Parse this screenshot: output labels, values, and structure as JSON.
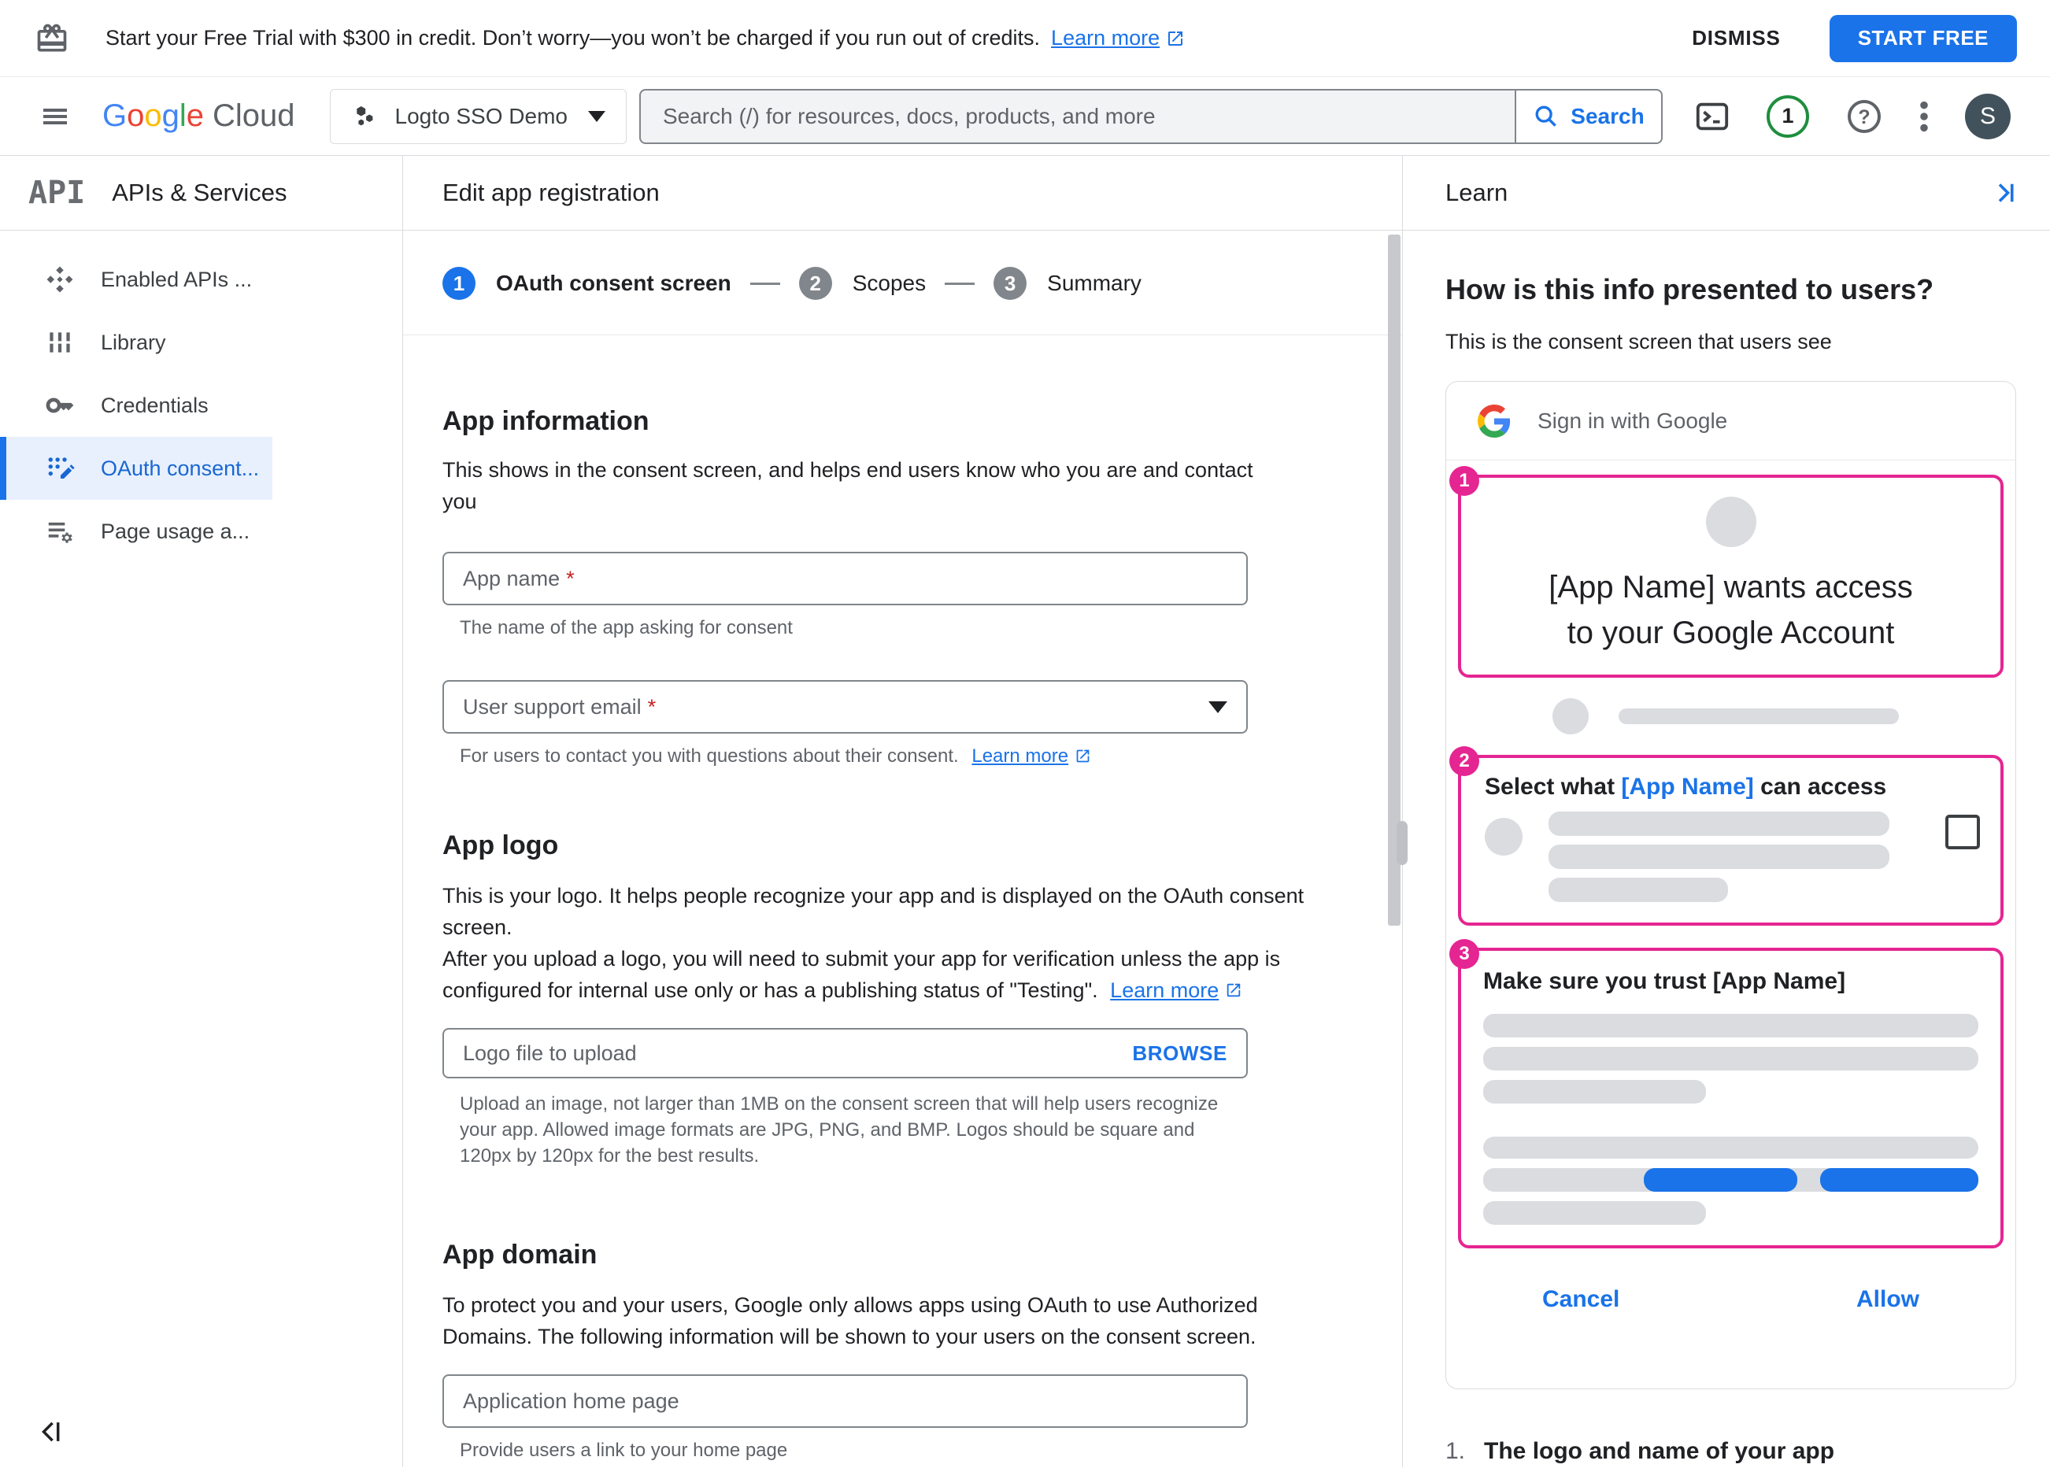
{
  "banner": {
    "message": "Start your Free Trial with $300 in credit. Don’t worry—you won’t be charged if you run out of credits.",
    "learn_more": "Learn more",
    "dismiss": "DISMISS",
    "start_free": "START FREE"
  },
  "header": {
    "logo": {
      "letters": [
        "G",
        "o",
        "o",
        "g",
        "l",
        "e"
      ],
      "cloud": "Cloud"
    },
    "project": "Logto SSO Demo",
    "search_placeholder": "Search (/) for resources, docs, products, and more",
    "search_label": "Search",
    "notification_count": "1",
    "avatar_initial": "S"
  },
  "sidebar": {
    "logo_text": "API",
    "title": "APIs & Services",
    "items": [
      {
        "label": "Enabled APIs ...",
        "selected": false
      },
      {
        "label": "Library",
        "selected": false
      },
      {
        "label": "Credentials",
        "selected": false
      },
      {
        "label": "OAuth consent...",
        "selected": true
      },
      {
        "label": "Page usage a...",
        "selected": false
      }
    ]
  },
  "main": {
    "title": "Edit app registration",
    "stepper": [
      {
        "number": "1",
        "label": "OAuth consent screen",
        "active": true
      },
      {
        "number": "2",
        "label": "Scopes",
        "active": false
      },
      {
        "number": "3",
        "label": "Summary",
        "active": false
      }
    ],
    "app_information": {
      "heading": "App information",
      "description": "This shows in the consent screen, and helps end users know who you are and contact you",
      "app_name": {
        "label": "App name",
        "required": "*",
        "helper": "The name of the app asking for consent"
      },
      "support_email": {
        "label": "User support email",
        "required": "*",
        "helper": "For users to contact you with questions about their consent.",
        "learn_more": "Learn more"
      }
    },
    "app_logo": {
      "heading": "App logo",
      "description1": "This is your logo. It helps people recognize your app and is displayed on the OAuth consent screen.",
      "description2": "After you upload a logo, you will need to submit your app for verification unless the app is configured for internal use only or has a publishing status of \"Testing\".",
      "learn_more": "Learn more",
      "upload": {
        "label": "Logo file to upload",
        "browse": "BROWSE",
        "helper": "Upload an image, not larger than 1MB on the consent screen that will help users recognize your app. Allowed image formats are JPG, PNG, and BMP. Logos should be square and 120px by 120px for the best results."
      }
    },
    "app_domain": {
      "heading": "App domain",
      "description": "To protect you and your users, Google only allows apps using OAuth to use Authorized Domains. The following information will be shown to your users on the consent screen.",
      "home_page": {
        "label": "Application home page",
        "helper": "Provide users a link to your home page"
      }
    }
  },
  "learn": {
    "title": "Learn",
    "heading": "How is this info presented to users?",
    "subheading": "This is the consent screen that users see",
    "signin": "Sign in with Google",
    "annotations": [
      {
        "number": "1"
      },
      {
        "number": "2"
      },
      {
        "number": "3"
      }
    ],
    "consent_title_line1": "[App Name] wants access",
    "consent_title_line2": "to your Google Account",
    "select_pre": "Select what ",
    "select_app": "[App Name]",
    "select_post": " can access",
    "trust_title": "Make sure you trust [App Name]",
    "cancel": "Cancel",
    "allow": "Allow",
    "footnote_number": "1.",
    "footnote_text": "The logo and name of your app"
  },
  "colors": {
    "accent_blue": "#1a73e8",
    "selected_nav_text": "#1967d2",
    "selected_nav_bg": "#e8f0fe",
    "annotation_pink": "#e52592",
    "notification_green": "#1e8e3e",
    "ghost_gray": "#dadce0"
  }
}
